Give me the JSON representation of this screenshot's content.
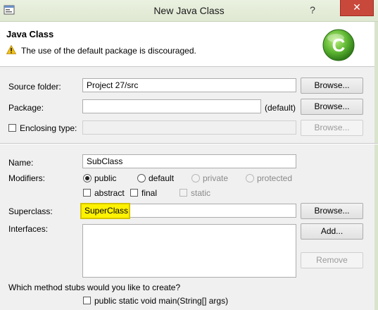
{
  "window": {
    "title": "New Java Class",
    "help_label": "?",
    "close_label": "✕"
  },
  "header": {
    "title": "Java Class",
    "message": "The use of the default package is discouraged.",
    "logo_letter": "C"
  },
  "form": {
    "source_folder": {
      "label": "Source folder:",
      "value": "Project 27/src",
      "button": "Browse..."
    },
    "package": {
      "label": "Package:",
      "value": "",
      "suffix": "(default)",
      "button": "Browse..."
    },
    "enclosing_type": {
      "label": "Enclosing type:",
      "value": "",
      "button": "Browse..."
    },
    "name": {
      "label": "Name:",
      "value": "SubClass"
    },
    "modifiers": {
      "label": "Modifiers:",
      "radios": [
        "public",
        "default",
        "private",
        "protected"
      ],
      "selected": "public",
      "checks": [
        "abstract",
        "final",
        "static"
      ]
    },
    "superclass": {
      "label": "Superclass:",
      "value": "SuperClass",
      "button": "Browse..."
    },
    "interfaces": {
      "label": "Interfaces:",
      "add_button": "Add...",
      "remove_button": "Remove"
    },
    "stubs": {
      "question": "Which method stubs would you like to create?",
      "main_method": "public static void main(String[] args)"
    }
  },
  "colors": {
    "highlight": "#fff200",
    "close_button": "#c9483c",
    "logo_green": "#5cb531"
  }
}
